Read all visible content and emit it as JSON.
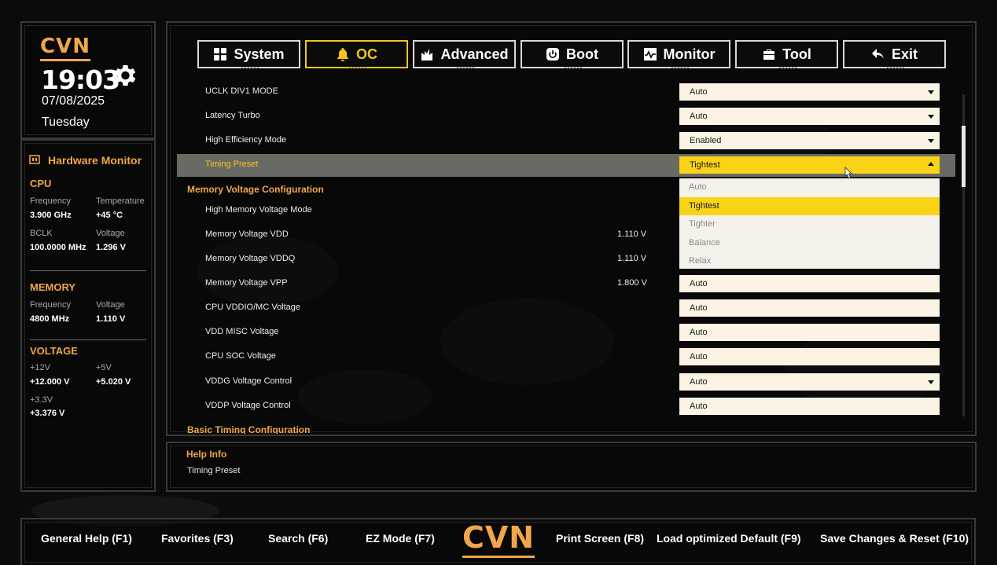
{
  "brand": {
    "logo_text": "CVN"
  },
  "clock": {
    "time": "19:03",
    "date": "07/08/2025",
    "day": "Tuesday"
  },
  "hardware_monitor": {
    "title": "Hardware Monitor",
    "cpu": {
      "section": "CPU",
      "freq_label": "Frequency",
      "freq_value": "3.900 GHz",
      "temp_label": "Temperature",
      "temp_value": "+45 °C",
      "bclk_label": "BCLK",
      "bclk_value": "100.0000 MHz",
      "volt_label": "Voltage",
      "volt_value": "1.296 V"
    },
    "memory": {
      "section": "MEMORY",
      "freq_label": "Frequency",
      "freq_value": "4800 MHz",
      "volt_label": "Voltage",
      "volt_value": "1.110 V"
    },
    "voltage": {
      "section": "VOLTAGE",
      "v12_label": "+12V",
      "v12_value": "+12.000 V",
      "v5_label": "+5V",
      "v5_value": "+5.020 V",
      "v33_label": "+3.3V",
      "v33_value": "+3.376 V"
    }
  },
  "tabs": [
    {
      "label": "System",
      "icon": "grid-icon"
    },
    {
      "label": "OC",
      "icon": "bell-icon",
      "active": true
    },
    {
      "label": "Advanced",
      "icon": "chip-icon"
    },
    {
      "label": "Boot",
      "icon": "power-icon"
    },
    {
      "label": "Monitor",
      "icon": "pulse-icon"
    },
    {
      "label": "Tool",
      "icon": "toolbox-icon"
    },
    {
      "label": "Exit",
      "icon": "return-icon"
    }
  ],
  "settings": {
    "rows": [
      {
        "label": "UCLK DIV1 MODE",
        "value": "",
        "field": "Auto",
        "dropdown": true
      },
      {
        "label": "Latency Turbo",
        "value": "",
        "field": "Auto",
        "dropdown": true
      },
      {
        "label": "High Efficiency Mode",
        "value": "",
        "field": "Enabled",
        "dropdown": true
      },
      {
        "label": "Timing Preset",
        "value": "",
        "field": "Tightest",
        "dropdown": true,
        "selected": true
      },
      {
        "label": "High Memory Voltage Mode",
        "value": "",
        "field": "",
        "dropdown": false
      },
      {
        "label": "Memory Voltage VDD",
        "value": "1.110 V",
        "field": "",
        "dropdown": false
      },
      {
        "label": "Memory Voltage VDDQ",
        "value": "1.110 V",
        "field": "",
        "dropdown": false
      },
      {
        "label": "Memory Voltage VPP",
        "value": "1.800 V",
        "field": "Auto",
        "dropdown": false
      },
      {
        "label": "CPU VDDIO/MC Voltage",
        "value": "",
        "field": "Auto",
        "dropdown": false
      },
      {
        "label": "VDD MISC Voltage",
        "value": "",
        "field": "Auto",
        "dropdown": false
      },
      {
        "label": "CPU SOC Voltage",
        "value": "",
        "field": "Auto",
        "dropdown": false
      },
      {
        "label": "VDDG Voltage Control",
        "value": "",
        "field": "Auto",
        "dropdown": true
      },
      {
        "label": "VDDP Voltage Control",
        "value": "",
        "field": "Auto",
        "dropdown": false
      }
    ],
    "group_memory_voltage": "Memory Voltage Configuration",
    "group_basic_timing": "Basic Timing Configuration"
  },
  "timing_dropdown": {
    "options": [
      "Auto",
      "Tightest",
      "Tighter",
      "Balance",
      "Relax"
    ],
    "selected": "Tightest"
  },
  "help": {
    "title": "Help Info",
    "text": "Timing Preset"
  },
  "footer": {
    "general_help": "General Help (F1)",
    "favorites": "Favorites (F3)",
    "search": "Search (F6)",
    "ez_mode": "EZ Mode (F7)",
    "print_screen": "Print Screen (F8)",
    "load_default": "Load optimized Default (F9)",
    "save_reset": "Save Changes & Reset (F10)"
  },
  "colors": {
    "accent": "#f0a64a",
    "highlight": "#f9d416",
    "field_bg": "#fbf3e3",
    "background": "#0b0b0b"
  }
}
